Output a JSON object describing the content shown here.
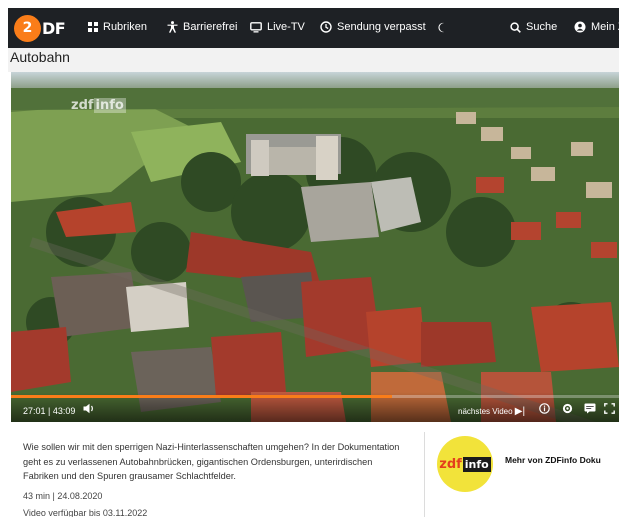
{
  "header": {
    "logo_text": "ZDF",
    "nav": [
      {
        "label": "Rubriken",
        "icon": "grid-icon"
      },
      {
        "label": "Barrierefrei",
        "icon": "accessibility-icon"
      },
      {
        "label": "Live-TV",
        "icon": "tv-icon"
      },
      {
        "label": "Sendung verpasst",
        "icon": "clock-icon"
      },
      {
        "label": "",
        "icon": "dark-mode-icon"
      },
      {
        "label": "Suche",
        "icon": "search-icon"
      },
      {
        "label": "Mein ZDF",
        "icon": "user-icon"
      }
    ]
  },
  "page": {
    "title": "Autobahn"
  },
  "player": {
    "watermark_zdf": "zdf",
    "watermark_info": "info",
    "current_time": "27:01",
    "duration": "43:09",
    "progress_fraction": 0.626,
    "next_video_label": "nächstes Video",
    "icons": [
      "volume-icon",
      "next-icon",
      "info-icon",
      "settings-icon",
      "subtitles-icon",
      "fullscreen-icon"
    ]
  },
  "description": {
    "text": "Wie sollen wir mit den sperrigen Nazi-Hinterlassenschaften umgehen? In der Dokumentation geht es zu verlassenen Autobahnbrücken, gigantischen Ordensburgen, unterirdischen Fabriken und den Spuren grausamer Schlachtfelder.",
    "meta": "43 min | 24.08.2020",
    "availability": "Video verfügbar bis 03.11.2022"
  },
  "channel": {
    "logo_zdf": "zdf",
    "logo_info": "info",
    "more_label": "Mehr von ZDFinfo Doku"
  },
  "colors": {
    "brand_orange": "#fa7d19",
    "nav_bg": "#1e2125",
    "zdfinfo_yellow": "#f2e33a"
  }
}
